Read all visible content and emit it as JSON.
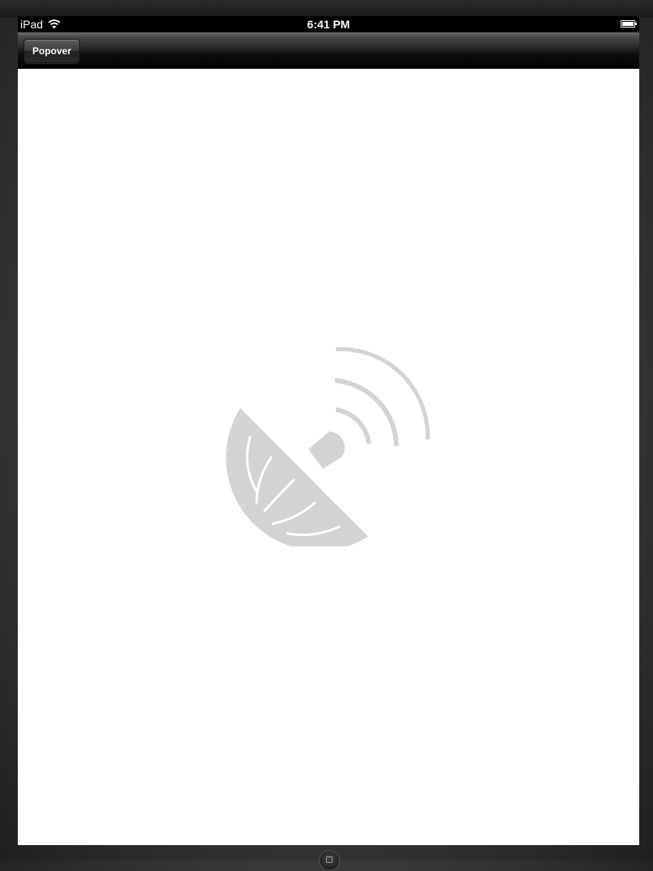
{
  "status_bar": {
    "carrier": "iPad",
    "time": "6:41 PM",
    "wifi_icon": "wifi-icon",
    "battery_icon": "battery-icon"
  },
  "nav_bar": {
    "left_button_label": "Popover"
  },
  "content": {
    "placeholder_icon": "satellite-dish-icon"
  },
  "device": {
    "home_button_icon": "home-button-icon"
  }
}
